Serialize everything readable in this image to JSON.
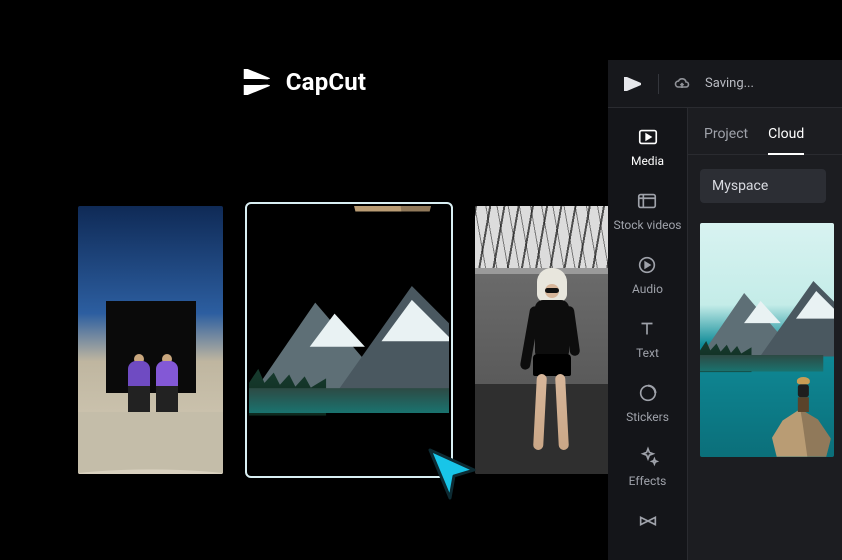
{
  "logo": {
    "text": "CapCut"
  },
  "topbar": {
    "status": "Saving..."
  },
  "rail": {
    "items": [
      {
        "id": "media",
        "label": "Media"
      },
      {
        "id": "stock",
        "label": "Stock videos"
      },
      {
        "id": "audio",
        "label": "Audio"
      },
      {
        "id": "text",
        "label": "Text"
      },
      {
        "id": "stickers",
        "label": "Stickers"
      },
      {
        "id": "effects",
        "label": "Effects"
      },
      {
        "id": "transitions",
        "label": ""
      }
    ],
    "active": "media"
  },
  "tabs": {
    "items": [
      {
        "id": "project",
        "label": "Project"
      },
      {
        "id": "cloud",
        "label": "Cloud"
      }
    ],
    "active": "cloud"
  },
  "breadcrumb": "Myspace"
}
